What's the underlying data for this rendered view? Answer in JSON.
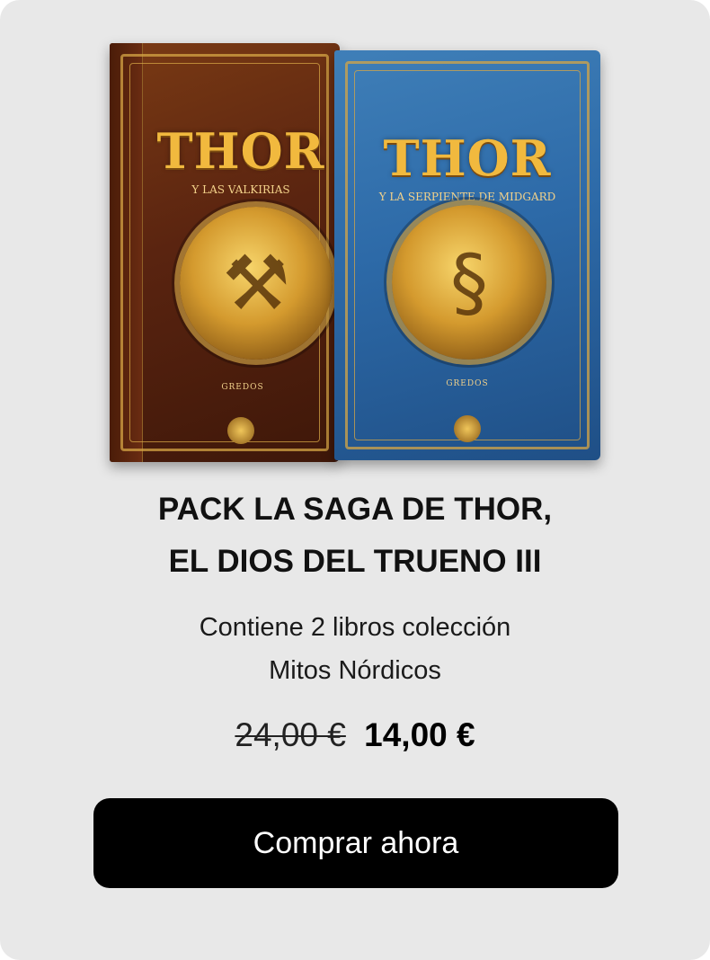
{
  "product": {
    "title_line1": "PACK LA SAGA DE THOR,",
    "title_line2": "EL DIOS DEL TRUENO III",
    "description_line1": "Contiene 2 libros colección",
    "description_line2": "Mitos Nórdicos",
    "old_price": "24,00 €",
    "new_price": "14,00 €",
    "buy_label": "Comprar ahora"
  },
  "image": {
    "book1": {
      "title": "THOR",
      "subtitle": "Y LAS VALKIRIAS",
      "publisher": "GREDOS",
      "cover_color": "#5a2410",
      "icon": "hammer-emblem"
    },
    "book2": {
      "title": "THOR",
      "subtitle": "Y LA SERPIENTE DE MIDGARD",
      "publisher": "GREDOS",
      "cover_color": "#2d6aa8",
      "icon": "serpent-emblem"
    }
  },
  "colors": {
    "card_background": "#e8e8e8",
    "button_background": "#000000",
    "button_text": "#ffffff",
    "gold_accent": "#f1b93e"
  }
}
